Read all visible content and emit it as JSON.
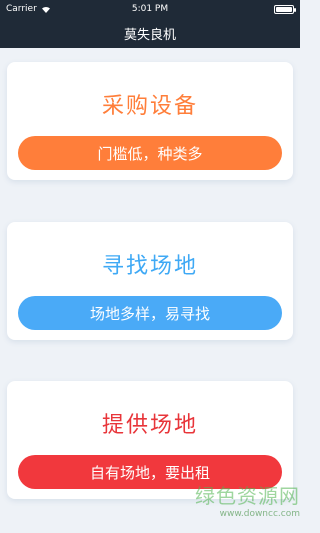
{
  "status_bar": {
    "carrier": "Carrier",
    "time": "5:01 PM"
  },
  "nav": {
    "title": "莫失良机"
  },
  "cards": [
    {
      "title": "采购设备",
      "button": "门槛低，种类多",
      "title_color": "#ff7e3a",
      "button_color": "#ff7e3a"
    },
    {
      "title": "寻找场地",
      "button": "场地多样，易寻找",
      "title_color": "#3fa9f5",
      "button_color": "#4aaaf7"
    },
    {
      "title": "提供场地",
      "button": "自有场地，要出租",
      "title_color": "#e8353a",
      "button_color": "#f1383d"
    }
  ],
  "watermark": {
    "main": "绿色资源网",
    "url": "www.downcc.com"
  }
}
